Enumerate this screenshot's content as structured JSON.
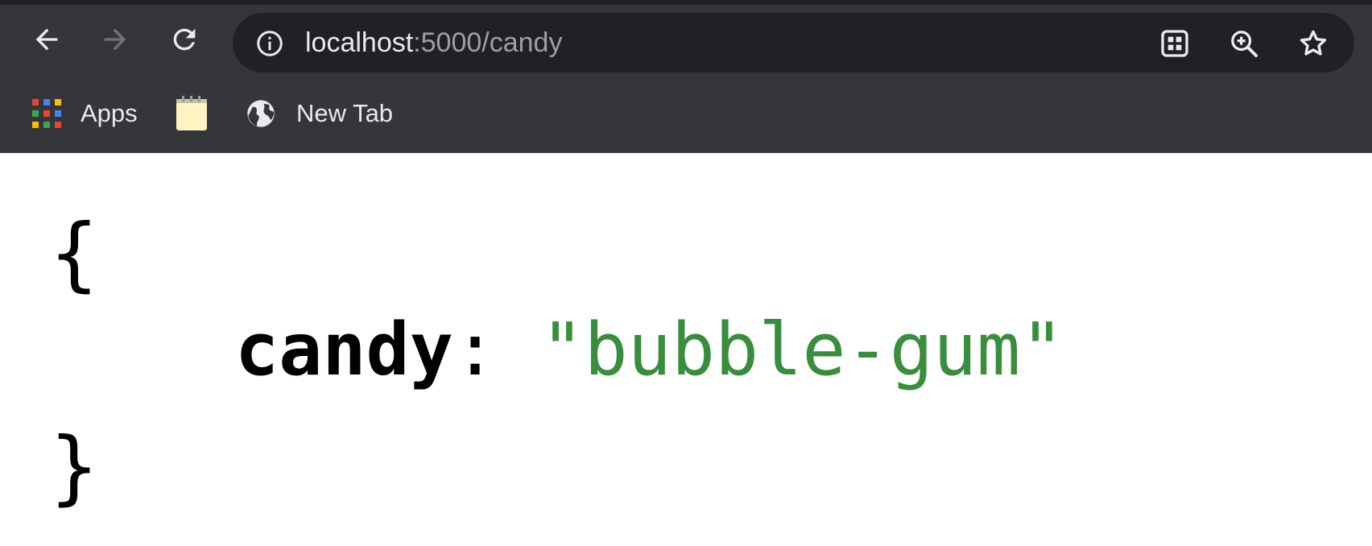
{
  "browser": {
    "address_bar": {
      "host": "localhost",
      "path": ":5000/candy"
    },
    "bookmarks": [
      {
        "label": "Apps",
        "icon": "apps-grid-icon"
      },
      {
        "label": "",
        "icon": "notepad-icon"
      },
      {
        "label": "New Tab",
        "icon": "globe-icon"
      }
    ]
  },
  "page": {
    "open_brace": "{",
    "key": "candy",
    "colon": ":",
    "value": "\"bubble-gum\"",
    "close_brace": "}"
  },
  "colors": {
    "toolbar_bg": "#35363a",
    "omnibox_bg": "#202124",
    "json_string": "#388e3c"
  }
}
